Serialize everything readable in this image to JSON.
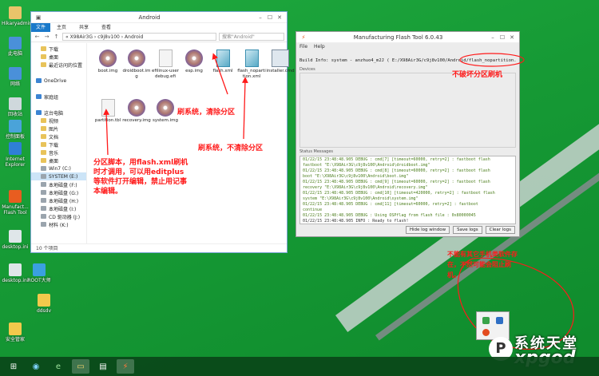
{
  "desktop": {
    "icons": [
      {
        "label": "Hikaryadmin"
      },
      {
        "label": "此电脑"
      },
      {
        "label": "网络"
      },
      {
        "label": "回收站"
      },
      {
        "label": "控制面板"
      },
      {
        "label": "Internet Explorer"
      },
      {
        "label": "Manufact... Flash Tool"
      },
      {
        "label": "desktop.ini"
      },
      {
        "label": "desktop.ini"
      },
      {
        "label": "ROOT大师"
      },
      {
        "label": "ddsdv"
      },
      {
        "label": "安全管家"
      }
    ]
  },
  "explorer": {
    "title": "Android",
    "ribbon": {
      "file": "文件",
      "tabs": [
        "主页",
        "共享",
        "查看"
      ]
    },
    "address": "« X98Air3G › c9j8v100 › Android",
    "search_placeholder": "搜索\"Android\"",
    "nav": [
      {
        "label": "下载",
        "sub": true,
        "icon": "folder"
      },
      {
        "label": "桌面",
        "sub": true,
        "icon": "folder"
      },
      {
        "label": "最近访问的位置",
        "sub": true,
        "icon": "folder"
      },
      {
        "label": "",
        "sub": false,
        "icon": ""
      },
      {
        "label": "OneDrive",
        "sub": false,
        "icon": "cloud"
      },
      {
        "label": "",
        "sub": false,
        "icon": ""
      },
      {
        "label": "家庭组",
        "sub": false,
        "icon": "homegroup"
      },
      {
        "label": "",
        "sub": false,
        "icon": ""
      },
      {
        "label": "这台电脑",
        "sub": false,
        "icon": "computer"
      },
      {
        "label": "视频",
        "sub": true,
        "icon": "folder"
      },
      {
        "label": "图片",
        "sub": true,
        "icon": "folder"
      },
      {
        "label": "文档",
        "sub": true,
        "icon": "folder"
      },
      {
        "label": "下载",
        "sub": true,
        "icon": "folder"
      },
      {
        "label": "音乐",
        "sub": true,
        "icon": "folder"
      },
      {
        "label": "桌面",
        "sub": true,
        "icon": "folder"
      },
      {
        "label": "Win7 (C:)",
        "sub": true,
        "icon": "drive"
      },
      {
        "label": "SYSTEM (E:)",
        "sub": true,
        "icon": "drive",
        "selected": true
      },
      {
        "label": "本地磁盘 (F:)",
        "sub": true,
        "icon": "drive"
      },
      {
        "label": "本地磁盘 (G:)",
        "sub": true,
        "icon": "drive"
      },
      {
        "label": "本地磁盘 (H:)",
        "sub": true,
        "icon": "drive"
      },
      {
        "label": "本地磁盘 (I:)",
        "sub": true,
        "icon": "drive"
      },
      {
        "label": "CD 驱动器 (J:)",
        "sub": true,
        "icon": "drive"
      },
      {
        "label": "材料 (K:)",
        "sub": true,
        "icon": "drive"
      }
    ],
    "files": [
      {
        "name": "boot.img",
        "kind": "disc"
      },
      {
        "name": "droidboot.img",
        "kind": "disc"
      },
      {
        "name": "efilinux-userdebug.efi",
        "kind": "doc"
      },
      {
        "name": "esp.img",
        "kind": "disc"
      },
      {
        "name": "flash.xml",
        "kind": "xml"
      },
      {
        "name": "flash_nopartition.xml",
        "kind": "xml"
      },
      {
        "name": "installer.cmd",
        "kind": "exe"
      },
      {
        "name": "partition.tbl",
        "kind": "doc"
      },
      {
        "name": "recovery.img",
        "kind": "disc"
      },
      {
        "name": "system.img",
        "kind": "disc"
      }
    ],
    "status": "10 个项目"
  },
  "flash_tool": {
    "title": "Manufacturing Flash Tool 6.0.43",
    "menu": [
      "File",
      "Help"
    ],
    "build_info": "Build Info: system - anzhuo4_m2J ( E:/X98Air3G/c9j8v100/Android/flash_nopartition.xml)",
    "devices_label": "Devices",
    "status_label": "Status Messages",
    "log": [
      {
        "text": "01/22/15 23:48:48.905  DEBUG  : cmd[7] [timeout=60000, retry=2] : fastboot flash",
        "level": "debug"
      },
      {
        "text": "fastboot \"E:\\X98Air3G\\c9j8v100\\Android\\droidboot.img\"",
        "level": "debug"
      },
      {
        "text": "01/22/15 23:48:48.905  DEBUG  : cmd[8] [timeout=60000, retry=2] : fastboot flash",
        "level": "debug"
      },
      {
        "text": "boot \"E:\\X98Air3G\\c9j8v100\\Android\\boot.img\"",
        "level": "debug"
      },
      {
        "text": "01/22/15 23:48:48.905  DEBUG  : cmd[9] [timeout=60000, retry=2] : fastboot flash",
        "level": "debug"
      },
      {
        "text": "recovery \"E:\\X98Air3G\\c9j8v100\\Android\\recovery.img\"",
        "level": "debug"
      },
      {
        "text": "01/22/15 23:48:48.905  DEBUG  : cmd[10] [timeout=420000, retry=2] : fastboot flash",
        "level": "debug"
      },
      {
        "text": "system \"E:\\X98Air3G\\c9j8v100\\Android\\system.img\"",
        "level": "debug"
      },
      {
        "text": "01/22/15 23:48:48.905  DEBUG  : cmd[11] [timeout=60000, retry=2] : fastboot",
        "level": "debug"
      },
      {
        "text": "continue",
        "level": "debug"
      },
      {
        "text": "01/22/15 23:48:48.905  DEBUG  : Using OSPflag from flash file : 0x80000045",
        "level": "debug"
      },
      {
        "text": "01/22/15 23:48:48.905  INFO   : Ready to flash!",
        "level": "info"
      }
    ],
    "buttons": {
      "hide": "Hide log window",
      "save": "Save logs",
      "clear": "Clear logs"
    }
  },
  "annotations": {
    "nopartition": "不破坏分区刷机",
    "flash_clear": "刷系统，清除分区",
    "flash_keep": "刷系统，不清除分区",
    "partition_note": "分区脚本，用flash.xml刷机时才调用，可以用editplus等软件打开编辑，禁止用记事本编辑。",
    "no_other": "不能有其它手机类软件存在，不然可能会阻止刷机。"
  },
  "watermark": {
    "line1": "系统天堂",
    "line2": "xpgod"
  },
  "colors": {
    "desktop": "#169a35",
    "annotation": "#ff1a1a",
    "ribbon_file": "#1979ca"
  }
}
